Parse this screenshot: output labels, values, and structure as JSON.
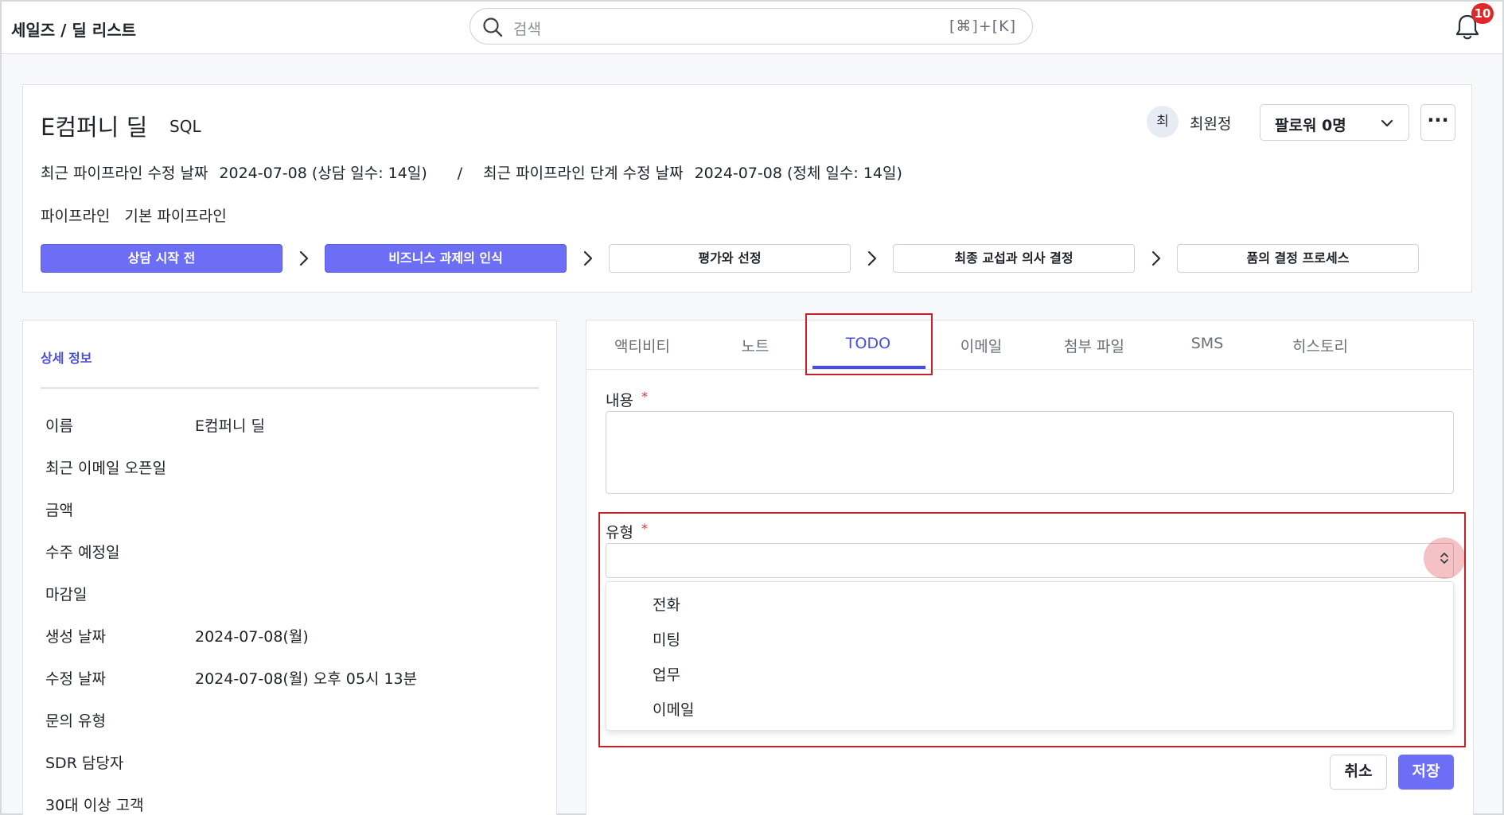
{
  "header": {
    "breadcrumb": "세일즈 / 딜 리스트",
    "search_placeholder": "검색",
    "search_shortcut": "[⌘]+[K]",
    "notification_count": "10"
  },
  "deal": {
    "title": "E컴퍼니 딜",
    "tag": "SQL",
    "owner_initial": "최",
    "owner_name": "최원정",
    "follow_label": "팔로워 0명",
    "more_label": "···",
    "pipeline_modified_label": "최근 파이프라인 수정 날짜",
    "pipeline_modified_value": "2024-07-08 (상담 일수: 14일)",
    "separator": "/",
    "stage_modified_label": "최근 파이프라인 단계 수정 날짜",
    "stage_modified_value": "2024-07-08 (정체 일수: 14일)",
    "pipeline_label": "파이프라인",
    "pipeline_value": "기본 파이프라인",
    "stages": [
      {
        "label": "상담 시작 전",
        "active": true
      },
      {
        "label": "비즈니스 과제의 인식",
        "active": true
      },
      {
        "label": "평가와 선정",
        "active": false
      },
      {
        "label": "최종 교섭과 의사 결정",
        "active": false
      },
      {
        "label": "품의 결정 프로세스",
        "active": false
      }
    ]
  },
  "details": {
    "heading": "상세 정보",
    "fields": [
      {
        "key": "이름",
        "value": "E컴퍼니 딜"
      },
      {
        "key": "최근 이메일 오픈일",
        "value": ""
      },
      {
        "key": "금액",
        "value": ""
      },
      {
        "key": "수주 예정일",
        "value": ""
      },
      {
        "key": "마감일",
        "value": ""
      },
      {
        "key": "생성 날짜",
        "value": "2024-07-08(월)"
      },
      {
        "key": "수정 날짜",
        "value": "2024-07-08(월) 오후 05시 13분"
      },
      {
        "key": "문의 유형",
        "value": ""
      },
      {
        "key": "SDR 담당자",
        "value": ""
      },
      {
        "key": "30대 이상 고객",
        "value": ""
      }
    ]
  },
  "tabs": {
    "items": [
      "액티비티",
      "노트",
      "TODO",
      "이메일",
      "첨부 파일",
      "SMS",
      "히스토리"
    ],
    "active": "TODO"
  },
  "todo_form": {
    "content_label": "내용",
    "type_label": "유형",
    "required_mark": "*",
    "type_options": [
      "전화",
      "미팅",
      "업무",
      "이메일"
    ],
    "cancel_label": "취소",
    "save_label": "저장"
  },
  "colors": {
    "accent": "#6c6ef5",
    "highlight": "#c8202a",
    "badge": "#e02828"
  }
}
